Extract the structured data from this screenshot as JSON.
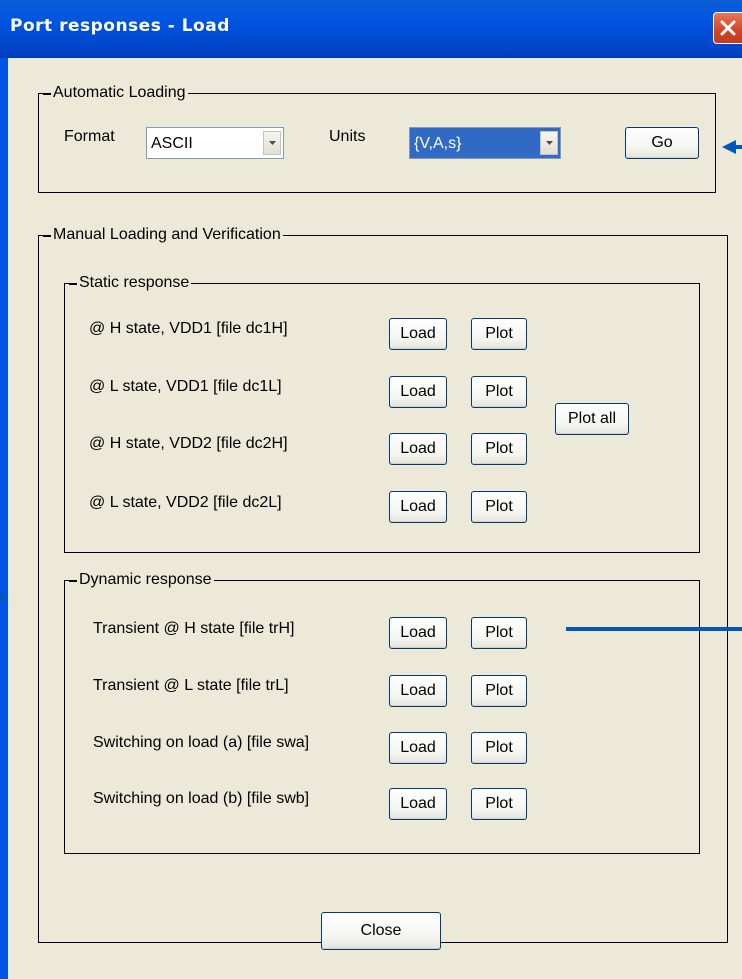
{
  "window": {
    "title": "Port responses - Load"
  },
  "colors": {
    "titlebar": "#0053e0",
    "close_button": "#d3472a",
    "selection": "#316ac5",
    "annotation": "#0058b8"
  },
  "automatic": {
    "legend": "Automatic Loading",
    "format_label": "Format",
    "format_value": "ASCII",
    "units_label": "Units",
    "units_value": "{V,A,s}",
    "go": "Go"
  },
  "manual": {
    "legend": "Manual Loading and Verification"
  },
  "static": {
    "legend": "Static response",
    "rows": [
      {
        "label": "@ H state, VDD1 [file dc1H]"
      },
      {
        "label": "@ L state, VDD1 [file dc1L]"
      },
      {
        "label": "@ H state, VDD2 [file dc2H]"
      },
      {
        "label": "@ L state, VDD2 [file dc2L]"
      }
    ],
    "plot_all": "Plot all"
  },
  "dynamic": {
    "legend": "Dynamic response",
    "rows": [
      {
        "label": "Transient @ H state [file trH]"
      },
      {
        "label": "Transient @ L state [file trL]"
      },
      {
        "label": "Switching on load (a) [file swa]"
      },
      {
        "label": "Switching on load (b) [file swb]"
      }
    ]
  },
  "buttons": {
    "load": "Load",
    "plot": "Plot",
    "close": "Close"
  }
}
